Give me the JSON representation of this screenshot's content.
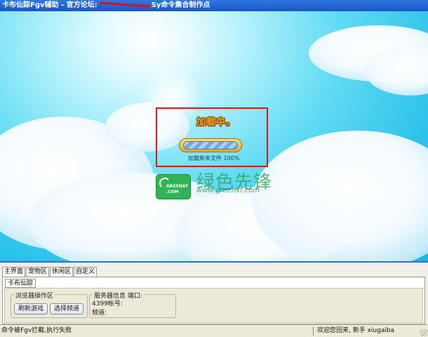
{
  "window": {
    "title_prefix": "卡布仙踪Fgv辅助 - 官方论坛:",
    "title_suffix": "Sy命令集合制作点"
  },
  "loading": {
    "title": "加载中。",
    "progress": 1.0,
    "status": "加载新本文件 100%"
  },
  "watermark": {
    "logo_line1": "GREENXF",
    "logo_line2": ".COM",
    "text": "绿色先锋",
    "url": "www.greenxf.com"
  },
  "tabs": [
    {
      "label": "主界面"
    },
    {
      "label": "宠物区"
    },
    {
      "label": "休闲区"
    },
    {
      "label": "自定义"
    }
  ],
  "subtab": {
    "label": "卡布仙踪"
  },
  "browser_group": {
    "legend": "浏览器操作区",
    "refresh_label": "刷新游戏",
    "select_label": "选择频道"
  },
  "server_group": {
    "legend": "服务器信息 端口:",
    "account_label": "4399帐号:",
    "channel_label": "频道:"
  },
  "status": {
    "left": "命令被Fgv拦截,执行失败",
    "right": "欢迎您回来, 新手 xiugaiba"
  },
  "colors": {
    "titlebar": "#1f5fd0",
    "highlight_box": "#d61a1a",
    "loading_title": "#f7a21a"
  }
}
